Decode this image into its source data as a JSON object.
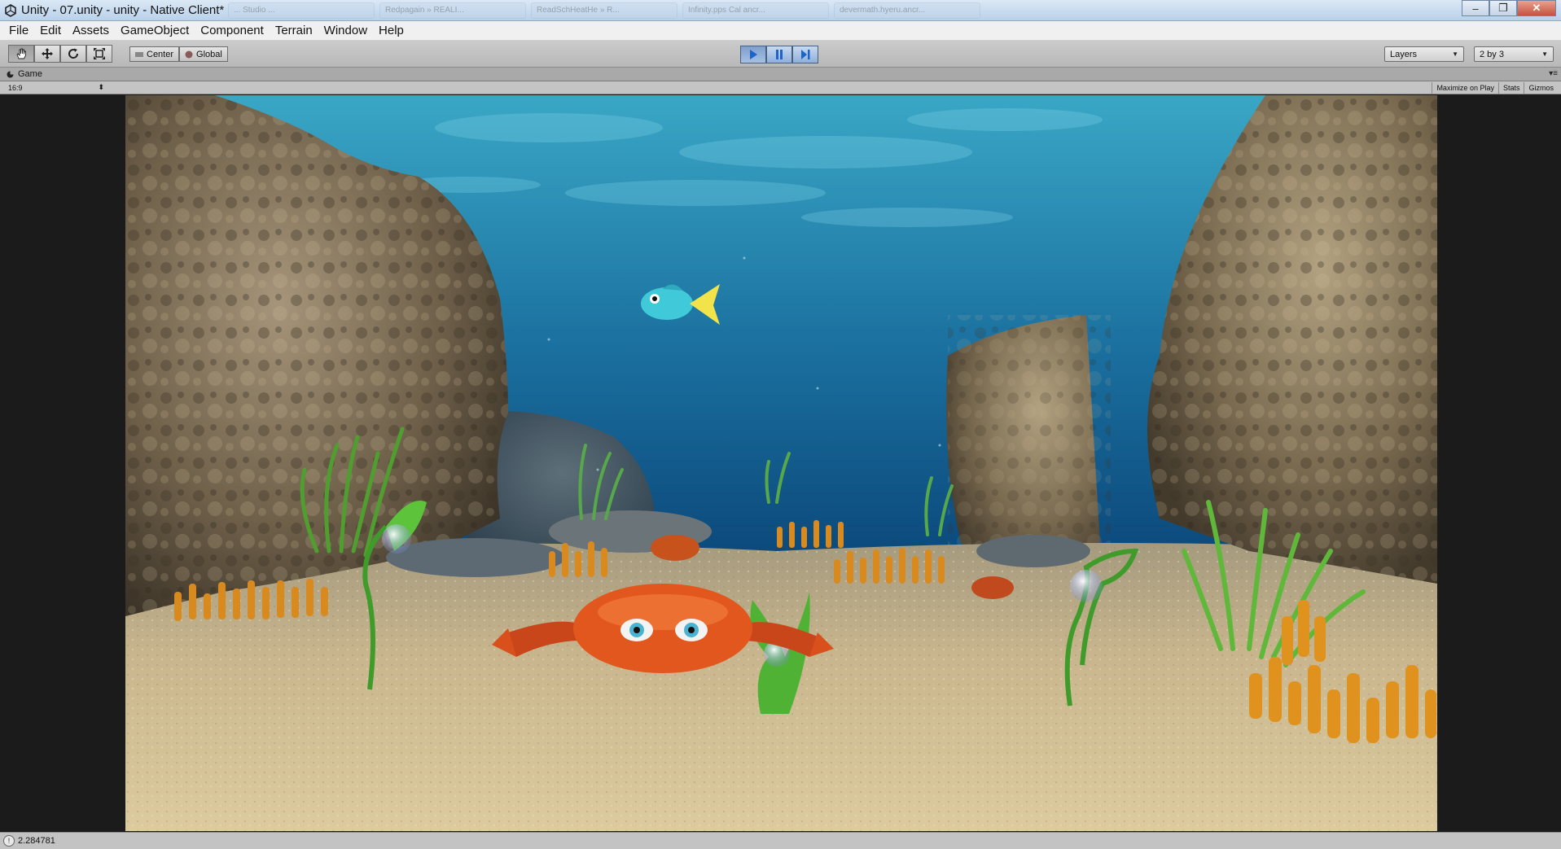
{
  "window": {
    "title": "Unity - 07.unity - unity - Native Client*",
    "background_tabs": [
      "... Studio ...",
      "Redpagain » REALI...",
      "ReadSchHeatHe » R...",
      "Infinity.pps Cal ancr...",
      "devermath.hyeru.ancr..."
    ],
    "minimize_label": "–",
    "restore_label": "❐",
    "close_label": "✕"
  },
  "menu": {
    "items": [
      "File",
      "Edit",
      "Assets",
      "GameObject",
      "Component",
      "Terrain",
      "Window",
      "Help"
    ]
  },
  "toolbar": {
    "tools": [
      "hand-icon",
      "move-icon",
      "rotate-icon",
      "scale-icon"
    ],
    "pivot_center": "Center",
    "pivot_global": "Global",
    "layers_label": "Layers",
    "layout_label": "2 by 3"
  },
  "game_view": {
    "tab_label": "Game",
    "aspect": "16:9",
    "maximize_on_play": "Maximize on Play",
    "stats": "Stats",
    "gizmos": "Gizmos"
  },
  "status": {
    "message": "2.284781"
  },
  "colors": {
    "water_top": "#2a8fb3",
    "water_deep": "#0b3f6e",
    "sand": "#c9b48a",
    "rock": "#8a7a5e",
    "crab": "#e2571e",
    "fish": "#3fc9d9",
    "play_accent": "#5b86c4"
  }
}
